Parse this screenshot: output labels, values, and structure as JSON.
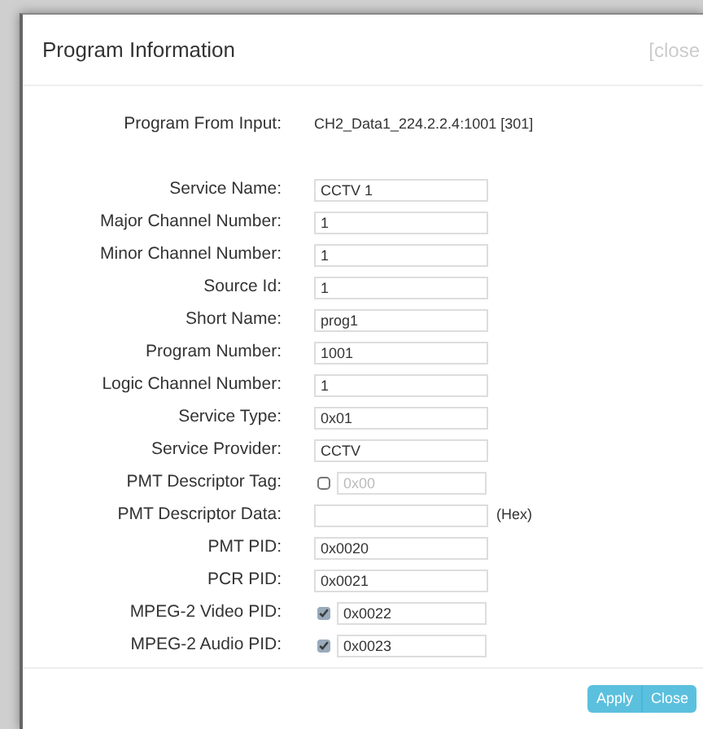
{
  "dialog": {
    "title": "Program Information",
    "close": "[close"
  },
  "source": {
    "label": "Program From Input:",
    "value": "CH2_Data1_224.2.2.4:1001 [301]"
  },
  "fields": [
    {
      "label": "Service Name:",
      "kind": "text",
      "value": "CCTV 1"
    },
    {
      "label": "Major Channel Number:",
      "kind": "text",
      "value": "1"
    },
    {
      "label": "Minor Channel Number:",
      "kind": "text",
      "value": "1"
    },
    {
      "label": "Source Id:",
      "kind": "text",
      "value": "1"
    },
    {
      "label": "Short Name:",
      "kind": "text",
      "value": "prog1"
    },
    {
      "label": "Program Number:",
      "kind": "text",
      "value": "1001"
    },
    {
      "label": "Logic Channel Number:",
      "kind": "text",
      "value": "1"
    },
    {
      "label": "Service Type:",
      "kind": "text",
      "value": "0x01"
    },
    {
      "label": "Service Provider:",
      "kind": "text",
      "value": "CCTV"
    },
    {
      "label": "PMT Descriptor Tag:",
      "kind": "check",
      "checked": false,
      "value": "0x00"
    },
    {
      "label": "PMT Descriptor Data:",
      "kind": "suffix",
      "suffix": "(Hex)"
    },
    {
      "label": "PMT PID:",
      "kind": "text",
      "value": "0x0020"
    },
    {
      "label": "PCR PID:",
      "kind": "text",
      "value": "0x0021"
    },
    {
      "label": "MPEG-2 Video PID:",
      "kind": "check",
      "checked": true,
      "value": "0x0022"
    },
    {
      "label": "MPEG-2 Audio PID:",
      "kind": "check",
      "checked": true,
      "value": "0x0023"
    }
  ],
  "buttons": [
    "Apply",
    "Close"
  ]
}
